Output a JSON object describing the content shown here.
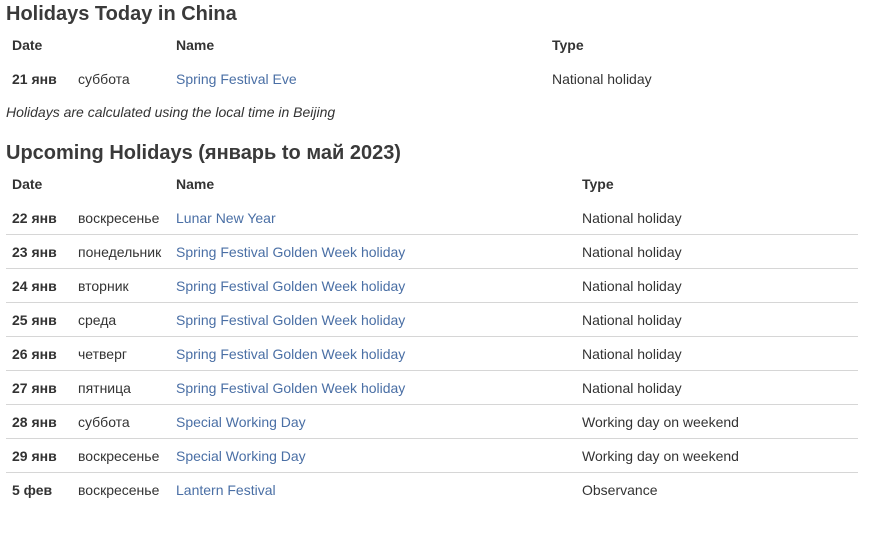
{
  "today": {
    "title": "Holidays Today in China",
    "headers": {
      "date": "Date",
      "name": "Name",
      "type": "Type"
    },
    "rows": [
      {
        "date": "21 янв",
        "weekday": "суббота",
        "name": "Spring Festival Eve",
        "type": "National holiday"
      }
    ],
    "note": "Holidays are calculated using the local time in Beijing"
  },
  "upcoming": {
    "title": "Upcoming Holidays (январь to май 2023)",
    "headers": {
      "date": "Date",
      "name": "Name",
      "type": "Type"
    },
    "rows": [
      {
        "date": "22 янв",
        "weekday": "воскресенье",
        "name": "Lunar New Year",
        "type": "National holiday"
      },
      {
        "date": "23 янв",
        "weekday": "понедельник",
        "name": "Spring Festival Golden Week holiday",
        "type": "National holiday"
      },
      {
        "date": "24 янв",
        "weekday": "вторник",
        "name": "Spring Festival Golden Week holiday",
        "type": "National holiday"
      },
      {
        "date": "25 янв",
        "weekday": "среда",
        "name": "Spring Festival Golden Week holiday",
        "type": "National holiday"
      },
      {
        "date": "26 янв",
        "weekday": "четверг",
        "name": "Spring Festival Golden Week holiday",
        "type": "National holiday"
      },
      {
        "date": "27 янв",
        "weekday": "пятница",
        "name": "Spring Festival Golden Week holiday",
        "type": "National holiday"
      },
      {
        "date": "28 янв",
        "weekday": "суббота",
        "name": "Special Working Day",
        "type": "Working day on weekend"
      },
      {
        "date": "29 янв",
        "weekday": "воскресенье",
        "name": "Special Working Day",
        "type": "Working day on weekend"
      },
      {
        "date": "5 фев",
        "weekday": "воскресенье",
        "name": "Lantern Festival",
        "type": "Observance"
      }
    ]
  },
  "colors": {
    "link": "#4a6fa5",
    "text": "#333333",
    "divider": "#d6d6d6"
  }
}
